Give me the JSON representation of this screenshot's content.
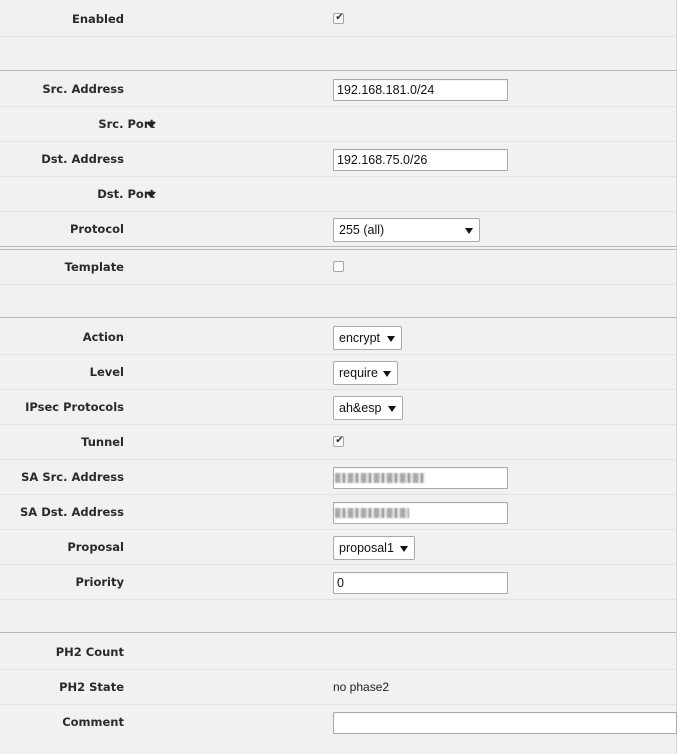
{
  "rows": {
    "enabled": {
      "label": "Enabled",
      "checked": true
    },
    "src_address": {
      "label": "Src. Address",
      "value": "192.168.181.0/24"
    },
    "src_port": {
      "label": "Src. Port"
    },
    "dst_address": {
      "label": "Dst. Address",
      "value": "192.168.75.0/26"
    },
    "dst_port": {
      "label": "Dst. Port"
    },
    "protocol": {
      "label": "Protocol",
      "value": "255 (all)"
    },
    "template": {
      "label": "Template",
      "checked": false
    },
    "action": {
      "label": "Action",
      "value": "encrypt"
    },
    "level": {
      "label": "Level",
      "value": "require"
    },
    "ipsec_protocols": {
      "label": "IPsec Protocols",
      "value": "ah&esp"
    },
    "tunnel": {
      "label": "Tunnel",
      "checked": true
    },
    "sa_src_address": {
      "label": "SA Src. Address",
      "value_redacted": true
    },
    "sa_dst_address": {
      "label": "SA Dst. Address",
      "value_redacted": true
    },
    "proposal": {
      "label": "Proposal",
      "value": "proposal1"
    },
    "priority": {
      "label": "Priority",
      "value": "0"
    },
    "ph2_count": {
      "label": "PH2 Count",
      "value": ""
    },
    "ph2_state": {
      "label": "PH2 State",
      "value": "no phase2"
    },
    "comment": {
      "label": "Comment",
      "value": ""
    }
  },
  "glyphs": {
    "check": "✔"
  }
}
